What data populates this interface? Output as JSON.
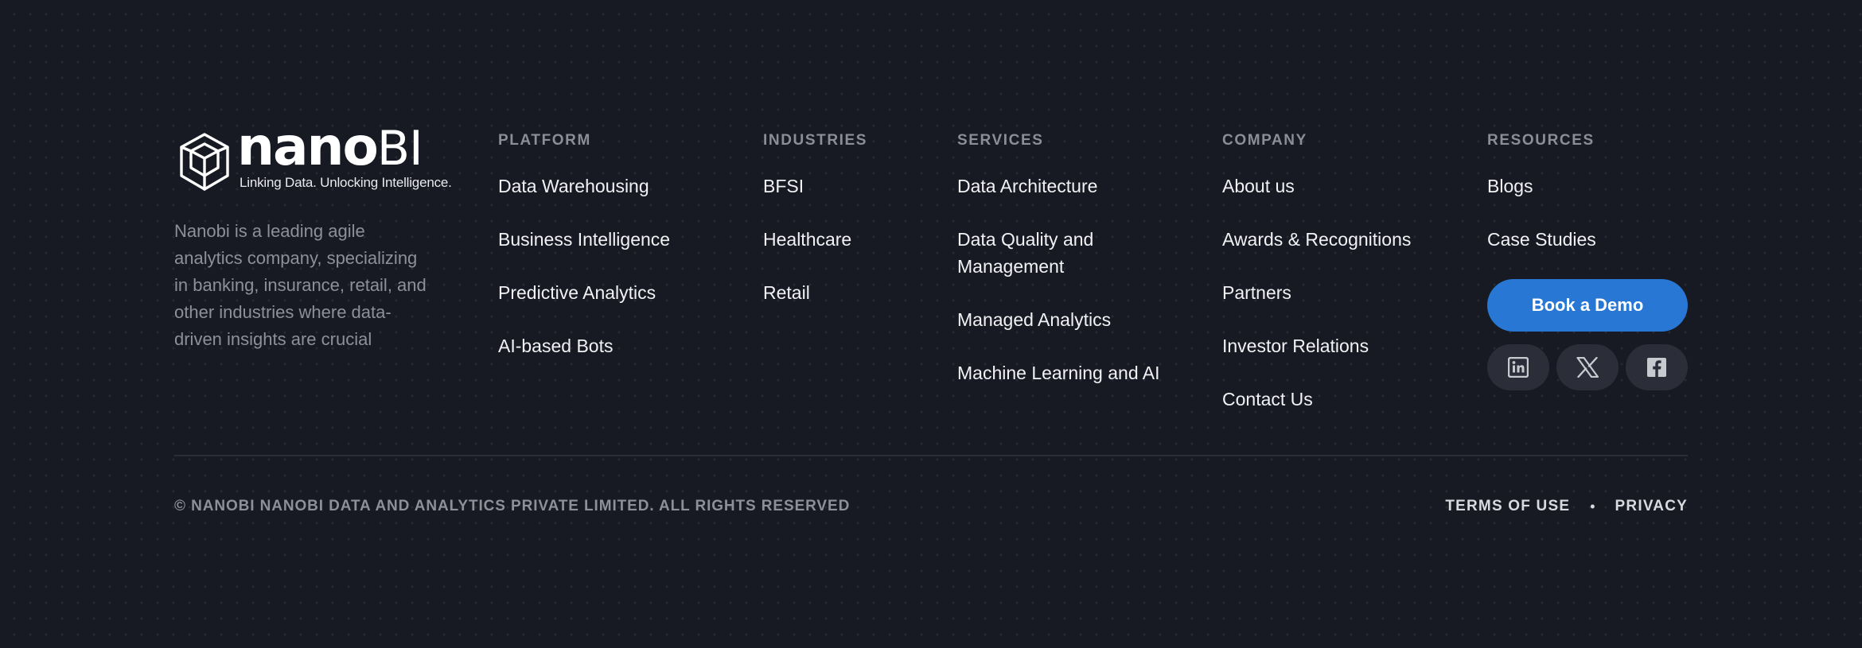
{
  "brand": {
    "logo_word": "nano",
    "logo_suffix": "BI",
    "tagline": "Linking Data. Unlocking Intelligence.",
    "description": "Nanobi is a leading agile analytics company, specializing in banking, insurance, retail, and other industries where data-driven insights are crucial",
    "logo_icon": "cube-network-icon"
  },
  "columns": {
    "platform": {
      "heading": "PLATFORM",
      "items": [
        "Data Warehousing",
        "Business Intelligence",
        "Predictive Analytics",
        "AI-based Bots"
      ]
    },
    "industries": {
      "heading": "INDUSTRIES",
      "items": [
        "BFSI",
        "Healthcare",
        "Retail"
      ]
    },
    "services": {
      "heading": "SERVICES",
      "items": [
        "Data Architecture",
        "Data Quality and Management",
        "Managed Analytics",
        "Machine Learning and AI"
      ]
    },
    "company": {
      "heading": "COMPANY",
      "items": [
        "About us",
        "Awards & Recognitions",
        "Partners",
        "Investor Relations",
        "Contact Us"
      ]
    },
    "resources": {
      "heading": "RESOURCES",
      "items": [
        "Blogs",
        "Case Studies"
      ],
      "cta_label": "Book a Demo",
      "socials": [
        "linkedin-icon",
        "x-twitter-icon",
        "facebook-icon"
      ]
    }
  },
  "bottom": {
    "copyright": "© NANOBI NANOBI DATA AND ANALYTICS PRIVATE LIMITED. ALL RIGHTS RESERVED",
    "terms_label": "TERMS OF USE",
    "separator": "•",
    "privacy_label": "PRIVACY"
  },
  "colors": {
    "background": "#181a23",
    "accent": "#2877d4",
    "heading": "#8b8d97",
    "link": "#f2f2f5",
    "muted": "#8d8f99",
    "social_bg": "#2b2e38"
  }
}
